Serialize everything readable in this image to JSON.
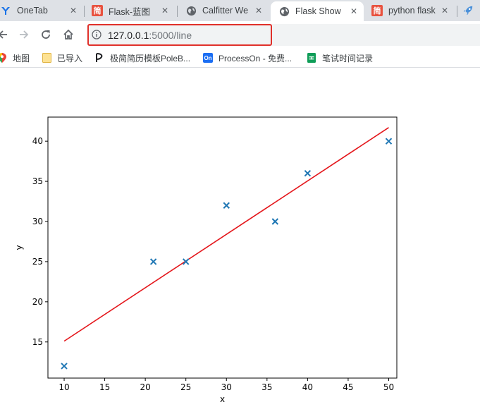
{
  "tabs": [
    {
      "title": "OneTab",
      "icon": "onetab-icon",
      "active": false
    },
    {
      "title": "Flask-蓝图",
      "icon": "jian-icon",
      "active": false
    },
    {
      "title": "Calfitter We",
      "icon": "globe-icon",
      "active": false
    },
    {
      "title": "Flask Show",
      "icon": "globe-icon",
      "active": true
    },
    {
      "title": "python flask",
      "icon": "jian-icon",
      "active": false
    }
  ],
  "tab_icon_text": "简",
  "address": {
    "host": "127.0.0.1",
    "path": ":5000/line"
  },
  "bookmarks": [
    {
      "label": "地图",
      "icon": "maps-pin-icon"
    },
    {
      "label": "已导入",
      "icon": "folder-icon"
    },
    {
      "label": "极简简历模板PoleB...",
      "icon": "poleb-icon"
    },
    {
      "label": "ProcessOn - 免费...",
      "icon": "processon-icon",
      "icon_text": "On"
    },
    {
      "label": "笔试时间记录",
      "icon": "sheets-icon"
    }
  ],
  "colors": {
    "scatter": "#1f77b4",
    "fit_line": "#e4161b",
    "highlight": "#e0302a"
  },
  "chart_data": {
    "type": "scatter",
    "xlabel": "x",
    "ylabel": "y",
    "xlim": [
      8,
      51
    ],
    "ylim": [
      10.5,
      43
    ],
    "xticks": [
      10,
      15,
      20,
      25,
      30,
      35,
      40,
      45,
      50
    ],
    "yticks": [
      15,
      20,
      25,
      30,
      35,
      40
    ],
    "points": [
      {
        "x": 10,
        "y": 12
      },
      {
        "x": 21,
        "y": 25
      },
      {
        "x": 25,
        "y": 25
      },
      {
        "x": 30,
        "y": 32
      },
      {
        "x": 36,
        "y": 30
      },
      {
        "x": 40,
        "y": 36
      },
      {
        "x": 50,
        "y": 40
      }
    ],
    "marker": "x",
    "fit_line": {
      "x": [
        10,
        50
      ],
      "y": [
        15.1,
        41.7
      ]
    }
  }
}
